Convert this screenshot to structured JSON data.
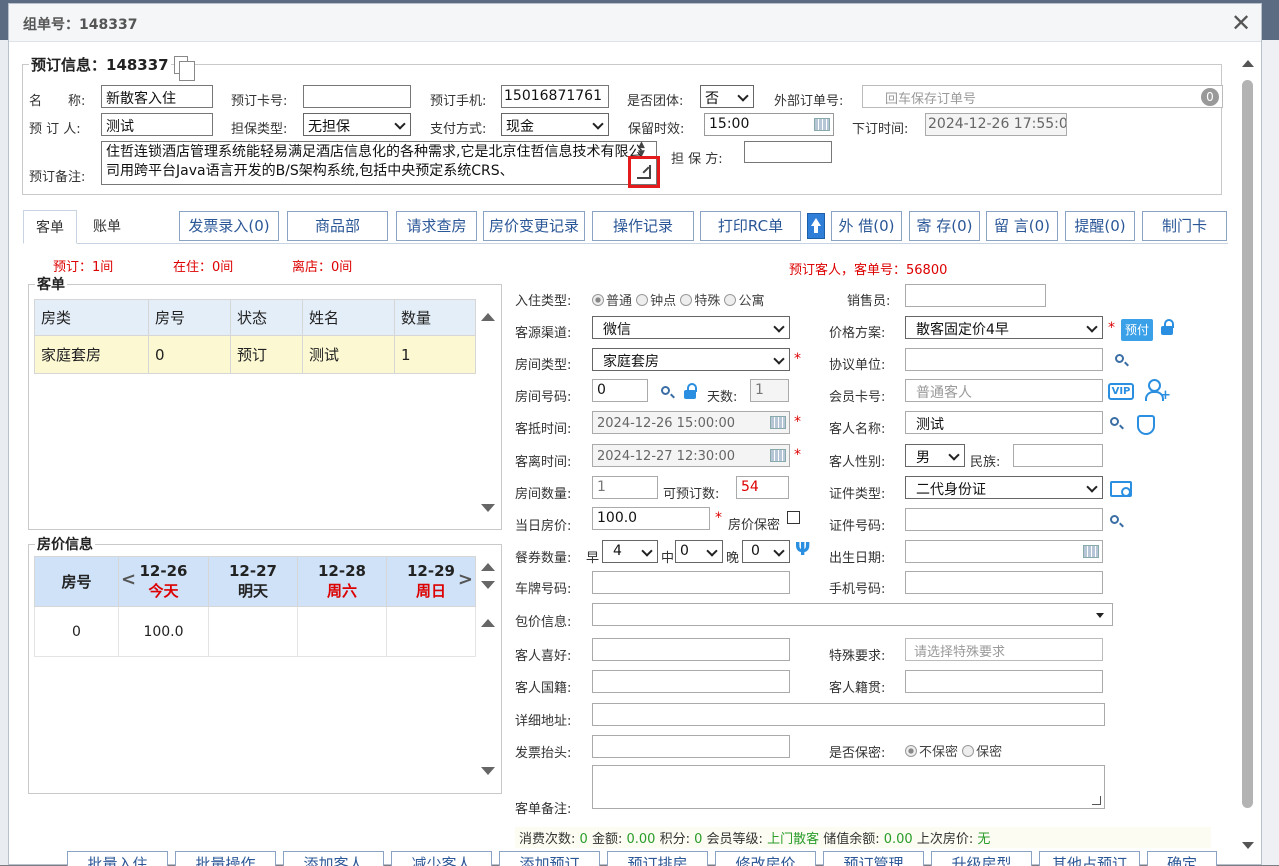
{
  "dialog": {
    "title": "组单号：148337"
  },
  "booking": {
    "section_title": "预订信息：148337",
    "name_label": "名　　称:",
    "name_value": "新散客入住",
    "card_label": "预订卡号:",
    "card_value": "",
    "phone_label": "预订手机:",
    "phone_value": "15016871761",
    "group_label": "是否团体:",
    "group_value": "否",
    "ext_label": "外部订单号:",
    "ext_placeholder": "回车保存订单号",
    "ext_badge": "0",
    "person_label": "预 订 人:",
    "person_value": "测试",
    "guarantee_label": "担保类型:",
    "guarantee_value": "无担保",
    "pay_label": "支付方式:",
    "pay_value": "现金",
    "hold_label": "保留时效:",
    "hold_value": "15:00",
    "order_time_label": "下订时间:",
    "order_time_value": "2024-12-26 17:55:0",
    "remark_label": "预订备注:",
    "remark_text": "住哲连锁酒店管理系统能轻易满足酒店信息化的各种需求,它是北京住哲信息技术有限公司用跨平台Java语言开发的B/S架构系统,包括中央预定系统CRS、",
    "guarantor_label": "担 保 方:",
    "guarantor_value": ""
  },
  "tabs": [
    "客单",
    "账单"
  ],
  "toolbar": [
    "发票录入(0)",
    "商品部",
    "请求查房",
    "房价变更记录",
    "操作记录",
    "打印RC单",
    "外 借(0)",
    "寄 存(0)",
    "留 言(0)",
    "提醒(0)",
    "制门卡"
  ],
  "status": {
    "reserved": "预订：1间",
    "inhouse": "在住：0间",
    "left": "离店：0间",
    "reserve_guest": "预订客人，客单号：56800"
  },
  "guest_list": {
    "legend": "客单",
    "headers": [
      "房类",
      "房号",
      "状态",
      "姓名",
      "数量"
    ],
    "rows": [
      [
        "家庭套房",
        "0",
        "预订",
        "测试",
        "1"
      ]
    ]
  },
  "price_info": {
    "legend": "房价信息",
    "room_header": "房号",
    "days": [
      {
        "date": "12-26",
        "week": "今天",
        "red": true
      },
      {
        "date": "12-27",
        "week": "明天",
        "red": false
      },
      {
        "date": "12-28",
        "week": "周六",
        "red": true
      },
      {
        "date": "12-29",
        "week": "周日",
        "red": true
      }
    ],
    "rows": [
      {
        "room": "0",
        "prices": [
          "100.0",
          "",
          "",
          ""
        ]
      }
    ]
  },
  "form": {
    "checkin_type_label": "入住类型:",
    "checkin_types": [
      "普通",
      "钟点",
      "特殊",
      "公寓"
    ],
    "sales_label": "销售员:",
    "sales_value": "",
    "source_label": "客源渠道:",
    "source_value": "微信",
    "plan_label": "价格方案:",
    "plan_value": "散客固定价4早",
    "prepay_badge": "预付",
    "roomtype_label": "房间类型:",
    "roomtype_value": "家庭套房",
    "agreement_label": "协议单位:",
    "agreement_value": "",
    "roomno_label": "房间号码:",
    "roomno_value": "0",
    "days_label": "天数:",
    "days_value": "1",
    "member_label": "会员卡号:",
    "member_placeholder": "普通客人",
    "arrive_label": "客抵时间:",
    "arrive_value": "2024-12-26 15:00:00",
    "guest_name_label": "客人名称:",
    "guest_name_value": "测试",
    "depart_label": "客离时间:",
    "depart_value": "2024-12-27 12:30:00",
    "gender_label": "客人性别:",
    "gender_value": "男",
    "ethnic_label": "民族:",
    "ethnic_value": "",
    "room_count_label": "房间数量:",
    "room_count_value": "1",
    "avail_label": "可预订数:",
    "avail_value": "54",
    "idtype_label": "证件类型:",
    "idtype_value": "二代身份证",
    "rate_label": "当日房价:",
    "rate_value": "100.0",
    "rate_secret_label": "房价保密",
    "idno_label": "证件号码:",
    "idno_value": "",
    "meal_label": "餐券数量:",
    "breakfast_label": "早",
    "breakfast_value": "4",
    "lunch_label": "中",
    "lunch_value": "0",
    "dinner_label": "晚",
    "dinner_value": "0",
    "birth_label": "出生日期:",
    "birth_value": "",
    "plate_label": "车牌号码:",
    "plate_value": "",
    "mobile_label": "手机号码:",
    "mobile_value": "",
    "package_label": "包价信息:",
    "package_value": "",
    "hobby_label": "客人喜好:",
    "hobby_value": "",
    "special_label": "特殊要求:",
    "special_placeholder": "请选择特殊要求",
    "nation_label": "客人国籍:",
    "nation_value": "",
    "native_label": "客人籍贯:",
    "native_value": "",
    "address_label": "详细地址:",
    "address_value": "",
    "invoice_label": "发票抬头:",
    "invoice_value": "",
    "secret_label": "是否保密:",
    "secret_options": [
      "不保密",
      "保密"
    ],
    "guest_remark_label": "客单备注:"
  },
  "summary": {
    "count_label": "消费次数:",
    "count_value": "0",
    "amount_label": "金额:",
    "amount_value": "0.00",
    "points_label": "积分:",
    "points_value": "0",
    "level_label": "会员等级:",
    "level_value": "上门散客",
    "balance_label": "储值余额:",
    "balance_value": "0.00",
    "last_label": "上次房价:",
    "last_value": "无"
  },
  "bottom_buttons": [
    "批量入住",
    "批量操作",
    "添加客人",
    "减少客人",
    "添加预订",
    "预订排房",
    "修改房价",
    "预订管理",
    "升级房型",
    "其他占预订",
    "确定"
  ]
}
